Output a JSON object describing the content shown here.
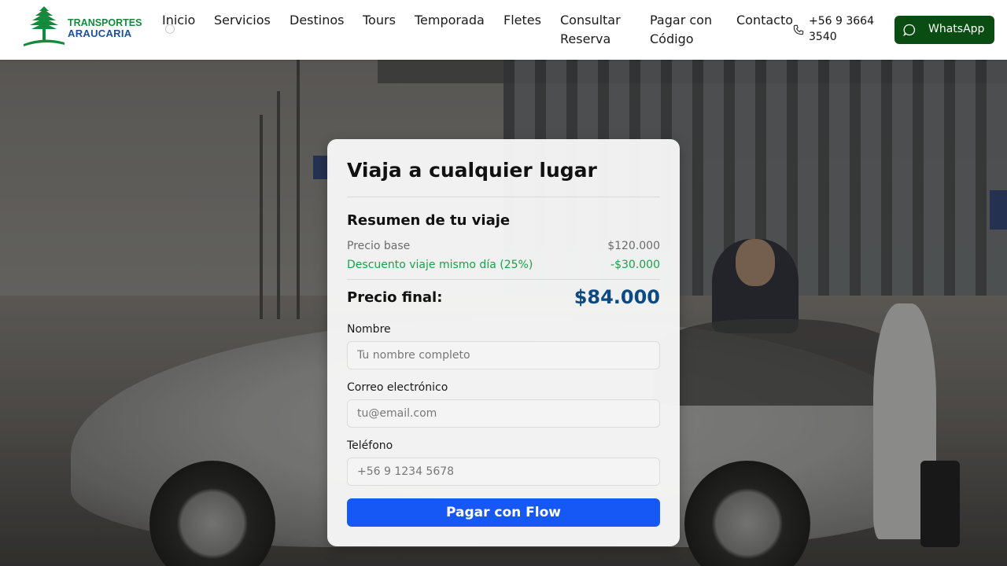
{
  "brand": {
    "line1": "TRANSPORTES",
    "line2": "ARAUCARIA",
    "logo_icon": "araucaria-tree-icon",
    "colors": {
      "green": "#138a3c",
      "blue": "#1c4f9c"
    }
  },
  "nav": {
    "items": [
      {
        "label": "Inicio"
      },
      {
        "label": "Servicios"
      },
      {
        "label": "Destinos"
      },
      {
        "label": "Tours"
      },
      {
        "label": "Temporada"
      },
      {
        "label": "Fletes"
      },
      {
        "label": "Consultar Reserva"
      },
      {
        "label": "Pagar con Código"
      },
      {
        "label": "Contacto"
      }
    ]
  },
  "contact": {
    "phone": "+56 9 3664 3540",
    "phone_icon": "phone-icon",
    "whatsapp_label": "WhatsApp",
    "whatsapp_icon": "whatsapp-icon",
    "whatsapp_color": "#0a4d12"
  },
  "booking": {
    "title": "Viaja a cualquier lugar",
    "summary_title": "Resumen de tu viaje",
    "base_label": "Precio base",
    "base_value": "$120.000",
    "discount_label": "Descuento viaje mismo día (25%)",
    "discount_value": "-$30.000",
    "final_label": "Precio final:",
    "final_value": "$84.000",
    "fields": {
      "name_label": "Nombre",
      "name_placeholder": "Tu nombre completo",
      "email_label": "Correo electrónico",
      "email_placeholder": "tu@email.com",
      "phone_label": "Teléfono",
      "phone_placeholder": "+56 9 1234 5678"
    },
    "pay_label": "Pagar con Flow",
    "pay_color": "#1658f5",
    "discount_color": "#17a34a",
    "final_color": "#0d4a84"
  }
}
